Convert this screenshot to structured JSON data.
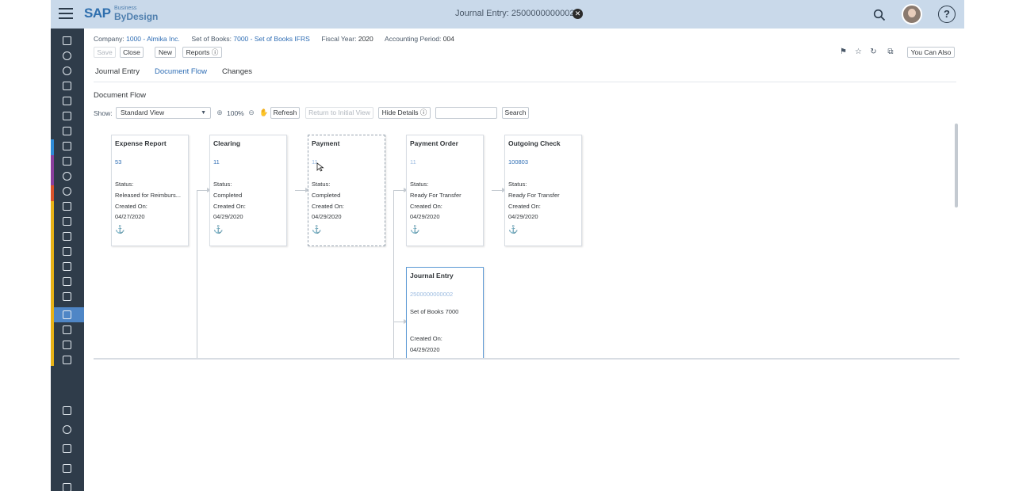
{
  "shell": {
    "title": "Journal Entry: 2500000000002",
    "logo_brand": "SAP",
    "logo_sub": "Business",
    "logo_product": "ByDesign",
    "help": "?"
  },
  "header": {
    "company_label": "Company:",
    "company_value": "1000 - Almika Inc.",
    "set_of_books_label": "Set of Books:",
    "set_of_books_value": "7000 - Set of Books IFRS",
    "fiscal_year_label": "Fiscal Year:",
    "fiscal_year_value": "2020",
    "accounting_period_label": "Accounting Period:",
    "accounting_period_value": "004"
  },
  "toolbar": {
    "save": "Save",
    "close": "Close",
    "new": "New",
    "reports": "Reports",
    "you_can_also": "You Can Also"
  },
  "tabs": [
    {
      "label": "Journal Entry",
      "active": false
    },
    {
      "label": "Document Flow",
      "active": true
    },
    {
      "label": "Changes",
      "active": false
    }
  ],
  "section": {
    "title": "Document Flow",
    "show_label": "Show:",
    "view_select": "Standard View",
    "zoom_level": "100%",
    "refresh": "Refresh",
    "return_initial": "Return to Initial View",
    "hide_details": "Hide Details",
    "search_value": "",
    "search_button": "Search"
  },
  "nodes": [
    {
      "title": "Expense Report",
      "number": "53",
      "status_label": "Status:",
      "status": "Released for Reimburs...",
      "created_label": "Created On:",
      "created": "04/27/2020"
    },
    {
      "title": "Clearing",
      "number": "11",
      "status_label": "Status:",
      "status": "Completed",
      "created_label": "Created On:",
      "created": "04/29/2020"
    },
    {
      "title": "Payment",
      "number": "11",
      "status_label": "Status:",
      "status": "Completed",
      "created_label": "Created On:",
      "created": "04/29/2020"
    },
    {
      "title": "Payment Order",
      "number": "11",
      "status_label": "Status:",
      "status": "Ready For Transfer",
      "created_label": "Created On:",
      "created": "04/29/2020"
    },
    {
      "title": "Outgoing Check",
      "number": "100803",
      "status_label": "Status:",
      "status": "Ready For Transfer",
      "created_label": "Created On:",
      "created": "04/29/2020"
    },
    {
      "title": "Journal Entry",
      "number": "2500000000002",
      "detail": "Set of Books 7000",
      "created_label": "Created On:",
      "created": "04/29/2020"
    }
  ],
  "colors": {
    "shellbar": "#c9d9ea",
    "sidebar": "#2f3c4a",
    "link": "#2e6db4",
    "active_item": "#4f86c6"
  }
}
